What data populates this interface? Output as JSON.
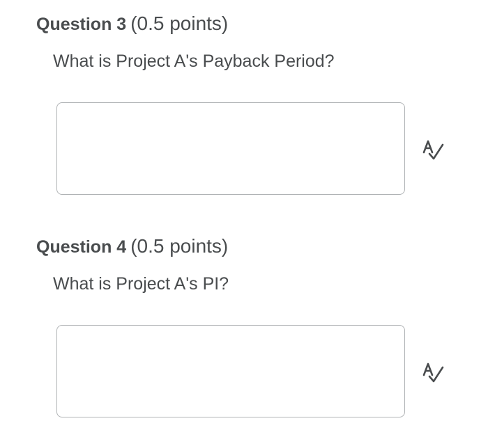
{
  "questions": [
    {
      "title": "Question 3",
      "points": "(0.5 points)",
      "prompt": "What is Project A's Payback Period?",
      "answer_value": "",
      "spellcheck_icon": "spellcheck-icon"
    },
    {
      "title": "Question 4",
      "points": "(0.5 points)",
      "prompt": "What is Project A's PI?",
      "answer_value": "",
      "spellcheck_icon": "spellcheck-icon"
    }
  ],
  "colors": {
    "text": "#494c4e",
    "border": "#b0b3b5",
    "icon": "#494c4e"
  }
}
